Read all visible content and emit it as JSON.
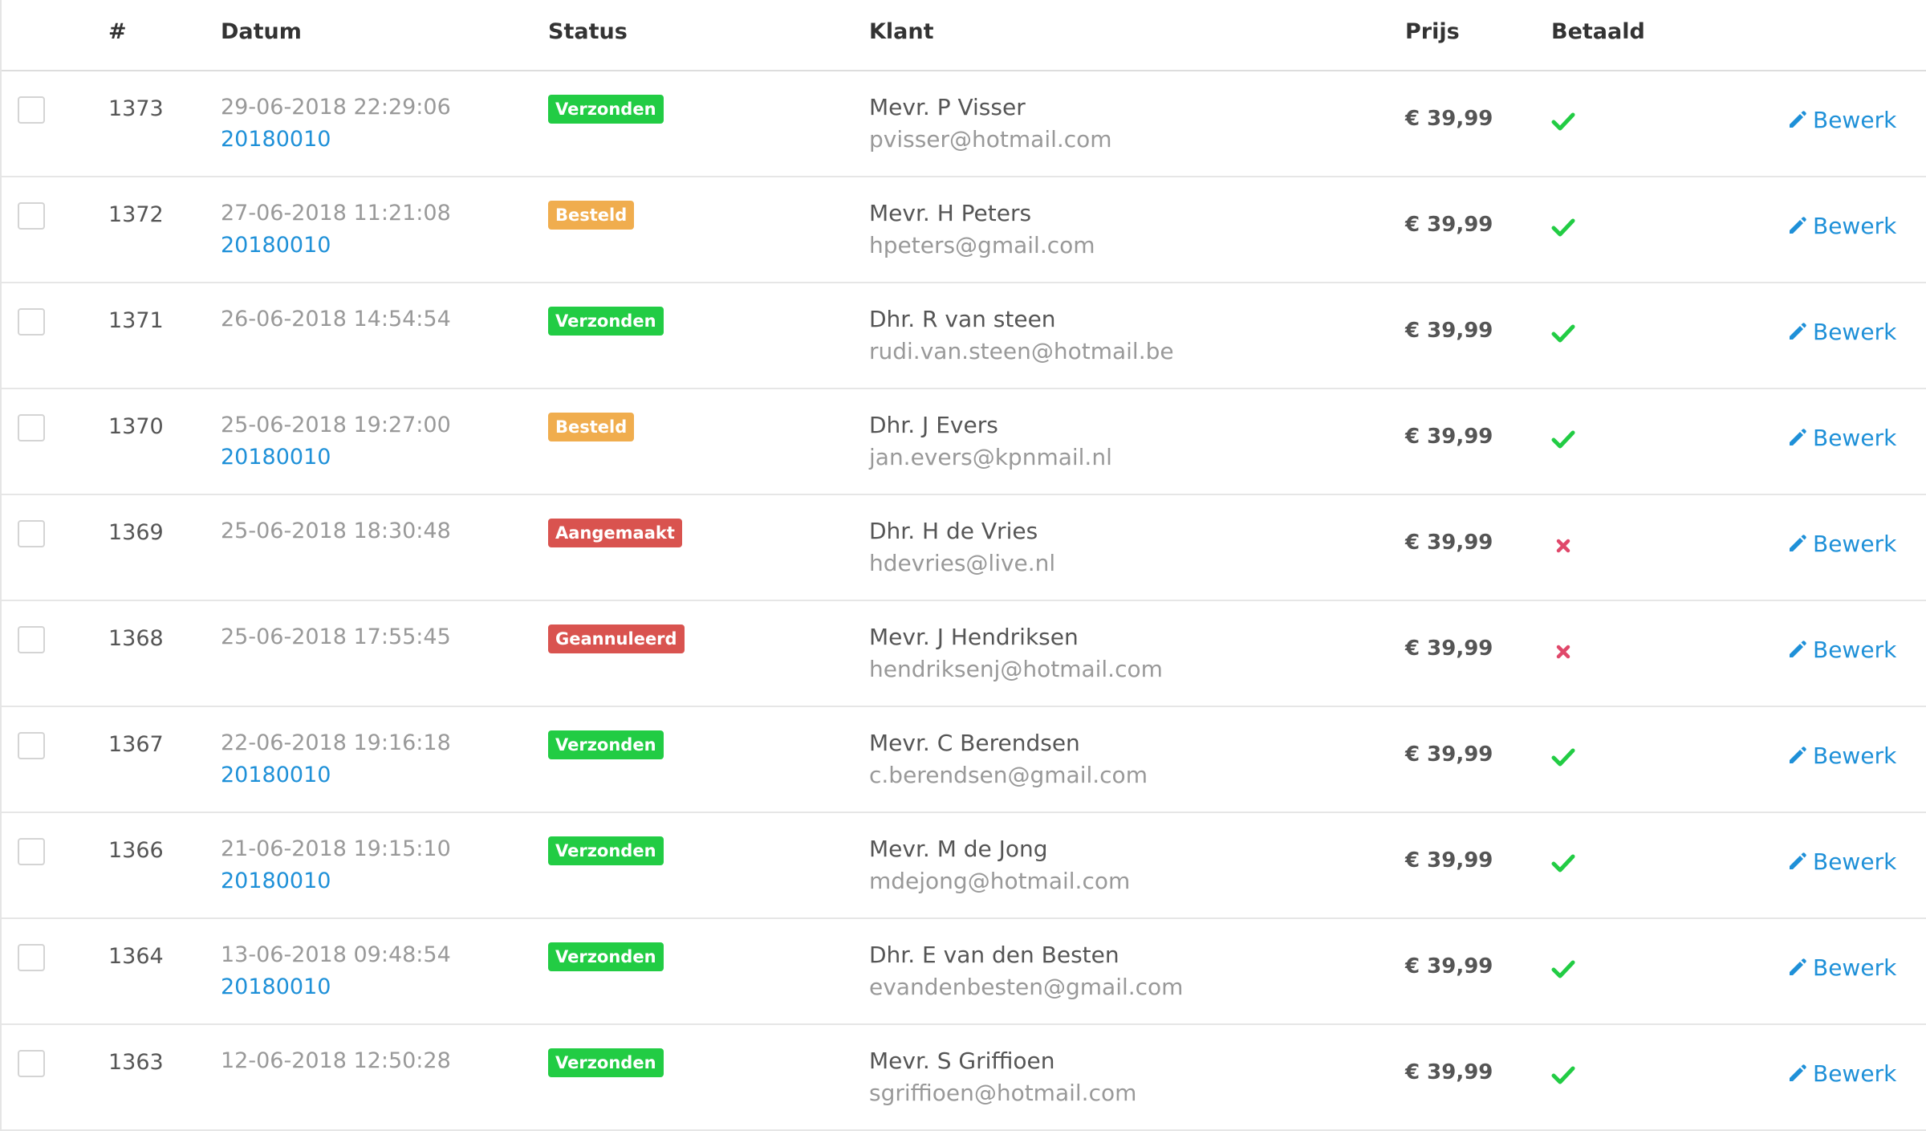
{
  "headers": {
    "num": "#",
    "date": "Datum",
    "status": "Status",
    "klant": "Klant",
    "prijs": "Prijs",
    "betaald": "Betaald"
  },
  "colors": {
    "link": "#1e90d8",
    "badge_green": "#22cc44",
    "badge_orange": "#f0ad4e",
    "badge_red": "#d9534f",
    "check": "#22cc44",
    "cross": "#e0486a"
  },
  "rows": [
    {
      "num": "1373",
      "date": "29-06-2018 22:29:06",
      "ref": "20180010",
      "status": "Verzonden",
      "status_color": "green",
      "name": "Mevr. P Visser",
      "email": "pvisser@hotmail.com",
      "price": "€ 39,99",
      "paid": true,
      "edit": "Bewerk"
    },
    {
      "num": "1372",
      "date": "27-06-2018 11:21:08",
      "ref": "20180010",
      "status": "Besteld",
      "status_color": "orange",
      "name": "Mevr. H Peters",
      "email": "hpeters@gmail.com",
      "price": "€ 39,99",
      "paid": true,
      "edit": "Bewerk"
    },
    {
      "num": "1371",
      "date": "26-06-2018 14:54:54",
      "ref": "",
      "status": "Verzonden",
      "status_color": "green",
      "name": "Dhr. R van steen",
      "email": "rudi.van.steen@hotmail.be",
      "price": "€ 39,99",
      "paid": true,
      "edit": "Bewerk"
    },
    {
      "num": "1370",
      "date": "25-06-2018 19:27:00",
      "ref": "20180010",
      "status": "Besteld",
      "status_color": "orange",
      "name": "Dhr. J Evers",
      "email": "jan.evers@kpnmail.nl",
      "price": "€ 39,99",
      "paid": true,
      "edit": "Bewerk"
    },
    {
      "num": "1369",
      "date": "25-06-2018 18:30:48",
      "ref": "",
      "status": "Aangemaakt",
      "status_color": "red",
      "name": "Dhr. H de Vries",
      "email": "hdevries@live.nl",
      "price": "€ 39,99",
      "paid": false,
      "edit": "Bewerk"
    },
    {
      "num": "1368",
      "date": "25-06-2018 17:55:45",
      "ref": "",
      "status": "Geannuleerd",
      "status_color": "red",
      "name": "Mevr. J Hendriksen",
      "email": "hendriksenj@hotmail.com",
      "price": "€ 39,99",
      "paid": false,
      "edit": "Bewerk"
    },
    {
      "num": "1367",
      "date": "22-06-2018 19:16:18",
      "ref": "20180010",
      "status": "Verzonden",
      "status_color": "green",
      "name": "Mevr. C Berendsen",
      "email": "c.berendsen@gmail.com",
      "price": "€ 39,99",
      "paid": true,
      "edit": "Bewerk"
    },
    {
      "num": "1366",
      "date": "21-06-2018 19:15:10",
      "ref": "20180010",
      "status": "Verzonden",
      "status_color": "green",
      "name": "Mevr. M de Jong",
      "email": "mdejong@hotmail.com",
      "price": "€ 39,99",
      "paid": true,
      "edit": "Bewerk"
    },
    {
      "num": "1364",
      "date": "13-06-2018 09:48:54",
      "ref": "20180010",
      "status": "Verzonden",
      "status_color": "green",
      "name": "Dhr. E van den Besten",
      "email": "evandenbesten@gmail.com",
      "price": "€ 39,99",
      "paid": true,
      "edit": "Bewerk"
    },
    {
      "num": "1363",
      "date": "12-06-2018 12:50:28",
      "ref": "",
      "status": "Verzonden",
      "status_color": "green",
      "name": "Mevr. S Griffioen",
      "email": "sgriffioen@hotmail.com",
      "price": "€ 39,99",
      "paid": true,
      "edit": "Bewerk"
    }
  ]
}
